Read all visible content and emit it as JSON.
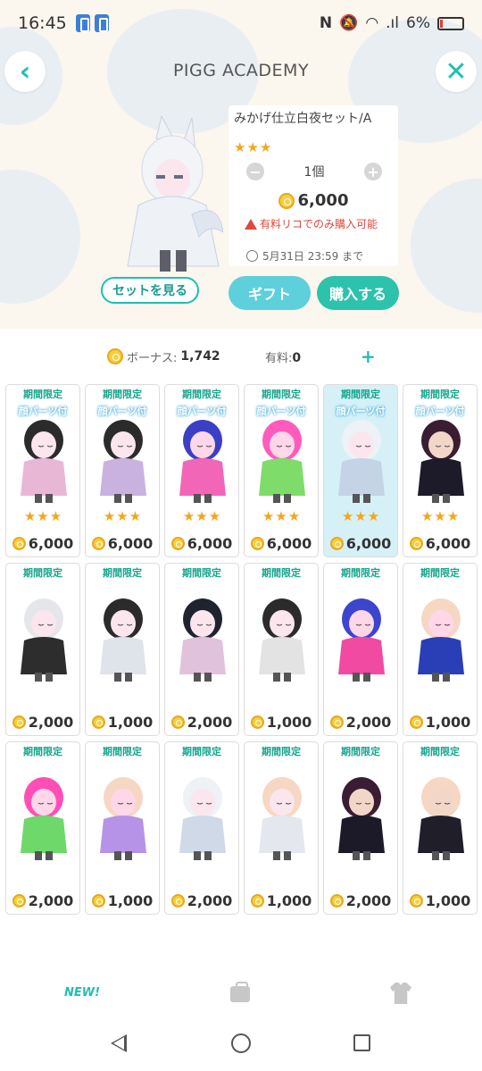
{
  "status_bar": {
    "time": "16:45",
    "battery": "6%"
  },
  "header": {
    "title": "PIGG ACADEMY",
    "back_icon": "chevron-left-icon",
    "close_icon": "close-icon"
  },
  "item": {
    "name": "みかげ仕立白夜セット/A",
    "rarity": 3,
    "quantity": "1個",
    "price": "6,000",
    "warning": "有料リコでのみ購入可能",
    "deadline": "5月31日 23:59 まで",
    "view_set_label": "セットを見る",
    "gift_label": "ギフト",
    "buy_label": "購入する"
  },
  "balance": {
    "bonus_label": "ボーナス:",
    "bonus_value": "1,742",
    "paid_label": "有料:",
    "paid_value": "0",
    "add_label": "+"
  },
  "grid": [
    {
      "limited": "期間限定",
      "parts": "顔パーツ付",
      "stars": 3,
      "price": "6,000",
      "selected": false,
      "palette": [
        "#2b2b2b",
        "#e9b7d6",
        "#fbe6ee"
      ]
    },
    {
      "limited": "期間限定",
      "parts": "顔パーツ付",
      "stars": 3,
      "price": "6,000",
      "selected": false,
      "palette": [
        "#2b2b2b",
        "#c9b2e0",
        "#fbe6ee"
      ]
    },
    {
      "limited": "期間限定",
      "parts": "顔パーツ付",
      "stars": 3,
      "price": "6,000",
      "selected": false,
      "palette": [
        "#3a3fc4",
        "#f266b8",
        "#ffd7e8"
      ]
    },
    {
      "limited": "期間限定",
      "parts": "顔パーツ付",
      "stars": 3,
      "price": "6,000",
      "selected": false,
      "palette": [
        "#ff5bbd",
        "#7edc6a",
        "#ffd7e8"
      ]
    },
    {
      "limited": "期間限定",
      "parts": "顔パーツ付",
      "stars": 3,
      "price": "6,000",
      "selected": true,
      "palette": [
        "#eef1f6",
        "#c5d3e6",
        "#fbe6ee"
      ]
    },
    {
      "limited": "期間限定",
      "parts": "顔パーツ付",
      "stars": 3,
      "price": "6,000",
      "selected": false,
      "palette": [
        "#3b1d33",
        "#1d1a2a",
        "#f2d7c8"
      ]
    },
    {
      "limited": "期間限定",
      "parts": "",
      "stars": 0,
      "price": "2,000",
      "selected": false,
      "palette": [
        "#e4e6ea",
        "#2d2d2d",
        "#fbe6ee"
      ]
    },
    {
      "limited": "期間限定",
      "parts": "",
      "stars": 0,
      "price": "1,000",
      "selected": false,
      "palette": [
        "#2b2b2b",
        "#dfe3ea",
        "#fbe6ee"
      ]
    },
    {
      "limited": "期間限定",
      "parts": "",
      "stars": 0,
      "price": "2,000",
      "selected": false,
      "palette": [
        "#1f2330",
        "#e0c2dc",
        "#fbe6ee"
      ]
    },
    {
      "limited": "期間限定",
      "parts": "",
      "stars": 0,
      "price": "1,000",
      "selected": false,
      "palette": [
        "#2b2b2b",
        "#e3e3e3",
        "#fbe6ee"
      ]
    },
    {
      "limited": "期間限定",
      "parts": "",
      "stars": 0,
      "price": "2,000",
      "selected": false,
      "palette": [
        "#3d45cf",
        "#f04aa3",
        "#ffd7e8"
      ]
    },
    {
      "limited": "期間限定",
      "parts": "",
      "stars": 0,
      "price": "1,000",
      "selected": false,
      "palette": [
        "#f6d7c4",
        "#2a3fb5",
        "#ffd7e8"
      ]
    },
    {
      "limited": "期間限定",
      "parts": "",
      "stars": 0,
      "price": "2,000",
      "selected": false,
      "palette": [
        "#ff4fb7",
        "#6fd86a",
        "#ffd7e8"
      ]
    },
    {
      "limited": "期間限定",
      "parts": "",
      "stars": 0,
      "price": "1,000",
      "selected": false,
      "palette": [
        "#f6d7c4",
        "#b693e6",
        "#ffd7e8"
      ]
    },
    {
      "limited": "期間限定",
      "parts": "",
      "stars": 0,
      "price": "2,000",
      "selected": false,
      "palette": [
        "#eef1f6",
        "#cfd9e8",
        "#fbe6ee"
      ]
    },
    {
      "limited": "期間限定",
      "parts": "",
      "stars": 0,
      "price": "1,000",
      "selected": false,
      "palette": [
        "#f6d7c4",
        "#e4e8ee",
        "#fbe6ee"
      ]
    },
    {
      "limited": "期間限定",
      "parts": "",
      "stars": 0,
      "price": "2,000",
      "selected": false,
      "palette": [
        "#3b1d33",
        "#1c1a28",
        "#f2d7c8"
      ]
    },
    {
      "limited": "期間限定",
      "parts": "",
      "stars": 0,
      "price": "1,000",
      "selected": false,
      "palette": [
        "#f6d7c4",
        "#1f1e29",
        "#f2d7c8"
      ]
    }
  ],
  "tabbar": {
    "new_label": "NEW!",
    "bag_icon": "bag-icon",
    "closet_icon": "shirt-icon"
  },
  "colors": {
    "accent": "#1fbfb0",
    "buy": "#2cc2ac",
    "gift": "#5ed0dc",
    "star": "#f4a61c",
    "warning": "#e0473e"
  }
}
